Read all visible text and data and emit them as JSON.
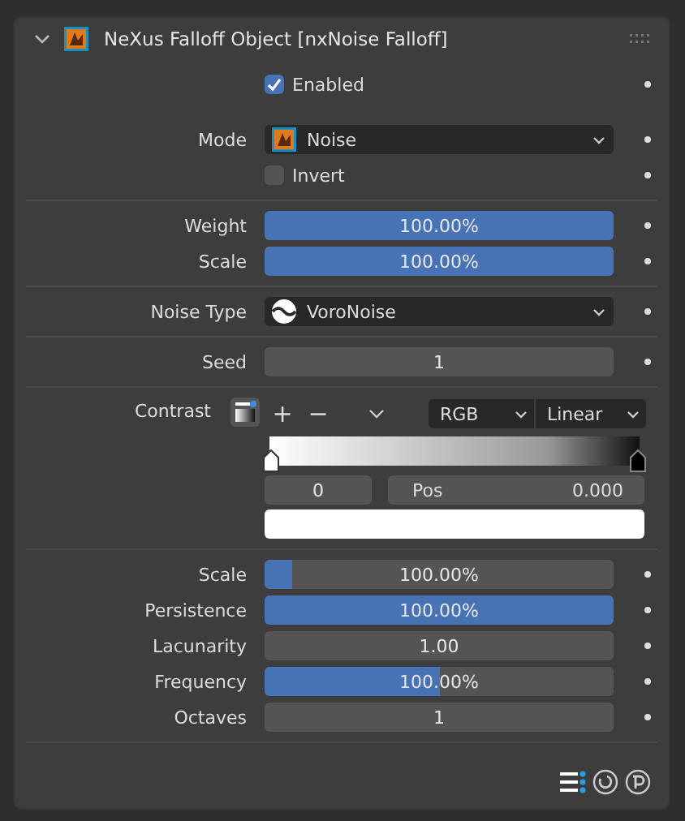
{
  "panel": {
    "title": "NeXus Falloff Object [nxNoise Falloff]",
    "expanded": true
  },
  "groups": [
    [
      {
        "kind": "checkbox",
        "label": "Enabled",
        "checked": true
      },
      {
        "kind": "dropdown",
        "label": "Mode",
        "value": "Noise"
      },
      {
        "kind": "checkbox",
        "label": "Invert",
        "checked": false
      }
    ],
    [
      {
        "kind": "slider",
        "label": "Weight",
        "value": "100.00%",
        "level": 1
      },
      {
        "kind": "slider",
        "label": "Scale",
        "value": "100.00%",
        "level": 1
      }
    ],
    [
      {
        "kind": "dropdown",
        "label": "Noise Type",
        "value": "VoroNoise"
      }
    ],
    [
      {
        "kind": "number",
        "label": "Seed",
        "value": "1"
      }
    ],
    [
      {
        "kind": "ramp",
        "label": "Contrast",
        "add": "+",
        "remove": "−",
        "color_mode": "RGB",
        "interpolation": "Linear",
        "stop_index": "0",
        "pos_label": "Pos",
        "pos_value": "0.000"
      }
    ],
    [
      {
        "kind": "slider",
        "label": "Scale",
        "value": "100.00%",
        "level": 0.08
      },
      {
        "kind": "slider",
        "label": "Persistence",
        "value": "100.00%",
        "level": 1
      },
      {
        "kind": "number",
        "label": "Lacunarity",
        "value": "1.00"
      },
      {
        "kind": "slider",
        "label": "Frequency",
        "value": "100.00%",
        "level": 0.5
      },
      {
        "kind": "number",
        "label": "Octaves",
        "value": "1"
      }
    ]
  ]
}
